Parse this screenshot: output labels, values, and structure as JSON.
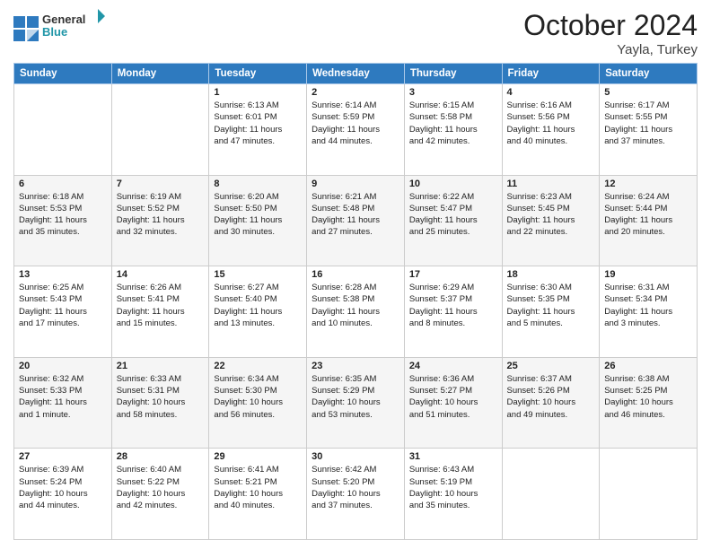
{
  "header": {
    "logo_line1": "General",
    "logo_line2": "Blue",
    "month": "October 2024",
    "location": "Yayla, Turkey"
  },
  "weekdays": [
    "Sunday",
    "Monday",
    "Tuesday",
    "Wednesday",
    "Thursday",
    "Friday",
    "Saturday"
  ],
  "rows": [
    [
      {
        "day": "",
        "lines": []
      },
      {
        "day": "",
        "lines": []
      },
      {
        "day": "1",
        "lines": [
          "Sunrise: 6:13 AM",
          "Sunset: 6:01 PM",
          "Daylight: 11 hours",
          "and 47 minutes."
        ]
      },
      {
        "day": "2",
        "lines": [
          "Sunrise: 6:14 AM",
          "Sunset: 5:59 PM",
          "Daylight: 11 hours",
          "and 44 minutes."
        ]
      },
      {
        "day": "3",
        "lines": [
          "Sunrise: 6:15 AM",
          "Sunset: 5:58 PM",
          "Daylight: 11 hours",
          "and 42 minutes."
        ]
      },
      {
        "day": "4",
        "lines": [
          "Sunrise: 6:16 AM",
          "Sunset: 5:56 PM",
          "Daylight: 11 hours",
          "and 40 minutes."
        ]
      },
      {
        "day": "5",
        "lines": [
          "Sunrise: 6:17 AM",
          "Sunset: 5:55 PM",
          "Daylight: 11 hours",
          "and 37 minutes."
        ]
      }
    ],
    [
      {
        "day": "6",
        "lines": [
          "Sunrise: 6:18 AM",
          "Sunset: 5:53 PM",
          "Daylight: 11 hours",
          "and 35 minutes."
        ]
      },
      {
        "day": "7",
        "lines": [
          "Sunrise: 6:19 AM",
          "Sunset: 5:52 PM",
          "Daylight: 11 hours",
          "and 32 minutes."
        ]
      },
      {
        "day": "8",
        "lines": [
          "Sunrise: 6:20 AM",
          "Sunset: 5:50 PM",
          "Daylight: 11 hours",
          "and 30 minutes."
        ]
      },
      {
        "day": "9",
        "lines": [
          "Sunrise: 6:21 AM",
          "Sunset: 5:48 PM",
          "Daylight: 11 hours",
          "and 27 minutes."
        ]
      },
      {
        "day": "10",
        "lines": [
          "Sunrise: 6:22 AM",
          "Sunset: 5:47 PM",
          "Daylight: 11 hours",
          "and 25 minutes."
        ]
      },
      {
        "day": "11",
        "lines": [
          "Sunrise: 6:23 AM",
          "Sunset: 5:45 PM",
          "Daylight: 11 hours",
          "and 22 minutes."
        ]
      },
      {
        "day": "12",
        "lines": [
          "Sunrise: 6:24 AM",
          "Sunset: 5:44 PM",
          "Daylight: 11 hours",
          "and 20 minutes."
        ]
      }
    ],
    [
      {
        "day": "13",
        "lines": [
          "Sunrise: 6:25 AM",
          "Sunset: 5:43 PM",
          "Daylight: 11 hours",
          "and 17 minutes."
        ]
      },
      {
        "day": "14",
        "lines": [
          "Sunrise: 6:26 AM",
          "Sunset: 5:41 PM",
          "Daylight: 11 hours",
          "and 15 minutes."
        ]
      },
      {
        "day": "15",
        "lines": [
          "Sunrise: 6:27 AM",
          "Sunset: 5:40 PM",
          "Daylight: 11 hours",
          "and 13 minutes."
        ]
      },
      {
        "day": "16",
        "lines": [
          "Sunrise: 6:28 AM",
          "Sunset: 5:38 PM",
          "Daylight: 11 hours",
          "and 10 minutes."
        ]
      },
      {
        "day": "17",
        "lines": [
          "Sunrise: 6:29 AM",
          "Sunset: 5:37 PM",
          "Daylight: 11 hours",
          "and 8 minutes."
        ]
      },
      {
        "day": "18",
        "lines": [
          "Sunrise: 6:30 AM",
          "Sunset: 5:35 PM",
          "Daylight: 11 hours",
          "and 5 minutes."
        ]
      },
      {
        "day": "19",
        "lines": [
          "Sunrise: 6:31 AM",
          "Sunset: 5:34 PM",
          "Daylight: 11 hours",
          "and 3 minutes."
        ]
      }
    ],
    [
      {
        "day": "20",
        "lines": [
          "Sunrise: 6:32 AM",
          "Sunset: 5:33 PM",
          "Daylight: 11 hours",
          "and 1 minute."
        ]
      },
      {
        "day": "21",
        "lines": [
          "Sunrise: 6:33 AM",
          "Sunset: 5:31 PM",
          "Daylight: 10 hours",
          "and 58 minutes."
        ]
      },
      {
        "day": "22",
        "lines": [
          "Sunrise: 6:34 AM",
          "Sunset: 5:30 PM",
          "Daylight: 10 hours",
          "and 56 minutes."
        ]
      },
      {
        "day": "23",
        "lines": [
          "Sunrise: 6:35 AM",
          "Sunset: 5:29 PM",
          "Daylight: 10 hours",
          "and 53 minutes."
        ]
      },
      {
        "day": "24",
        "lines": [
          "Sunrise: 6:36 AM",
          "Sunset: 5:27 PM",
          "Daylight: 10 hours",
          "and 51 minutes."
        ]
      },
      {
        "day": "25",
        "lines": [
          "Sunrise: 6:37 AM",
          "Sunset: 5:26 PM",
          "Daylight: 10 hours",
          "and 49 minutes."
        ]
      },
      {
        "day": "26",
        "lines": [
          "Sunrise: 6:38 AM",
          "Sunset: 5:25 PM",
          "Daylight: 10 hours",
          "and 46 minutes."
        ]
      }
    ],
    [
      {
        "day": "27",
        "lines": [
          "Sunrise: 6:39 AM",
          "Sunset: 5:24 PM",
          "Daylight: 10 hours",
          "and 44 minutes."
        ]
      },
      {
        "day": "28",
        "lines": [
          "Sunrise: 6:40 AM",
          "Sunset: 5:22 PM",
          "Daylight: 10 hours",
          "and 42 minutes."
        ]
      },
      {
        "day": "29",
        "lines": [
          "Sunrise: 6:41 AM",
          "Sunset: 5:21 PM",
          "Daylight: 10 hours",
          "and 40 minutes."
        ]
      },
      {
        "day": "30",
        "lines": [
          "Sunrise: 6:42 AM",
          "Sunset: 5:20 PM",
          "Daylight: 10 hours",
          "and 37 minutes."
        ]
      },
      {
        "day": "31",
        "lines": [
          "Sunrise: 6:43 AM",
          "Sunset: 5:19 PM",
          "Daylight: 10 hours",
          "and 35 minutes."
        ]
      },
      {
        "day": "",
        "lines": []
      },
      {
        "day": "",
        "lines": []
      }
    ]
  ]
}
